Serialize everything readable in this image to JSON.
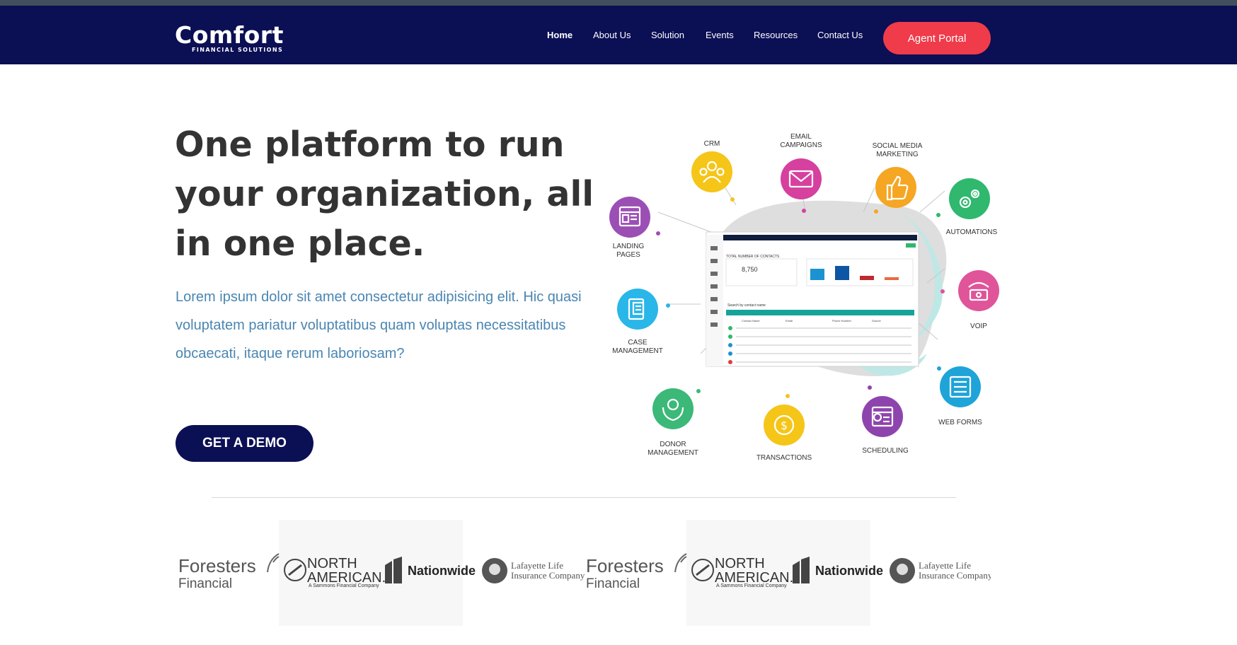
{
  "brand": {
    "name": "Comfort",
    "tagline": "FINANCIAL SOLUTIONS"
  },
  "nav": {
    "items": [
      {
        "label": "Home",
        "active": true
      },
      {
        "label": "About Us",
        "active": false
      },
      {
        "label": "Solution",
        "active": false
      },
      {
        "label": "Events",
        "active": false
      },
      {
        "label": "Resources",
        "active": false
      },
      {
        "label": "Contact Us",
        "active": false
      }
    ],
    "agent_portal": "Agent Portal"
  },
  "hero": {
    "title": "One platform to run your organization, all in one place.",
    "body": "Lorem ipsum dolor sit amet consectetur adipisicing elit. Hic quasi voluptatem pariatur voluptatibus quam voluptas necessitatibus obcaecati, itaque rerum laboriosam?",
    "cta": "GET A DEMO"
  },
  "illustration": {
    "features": [
      {
        "label": "CRM",
        "icon": "people-icon",
        "color": "#f5c518"
      },
      {
        "label": "EMAIL CAMPAIGNS",
        "icon": "envelope-icon",
        "color": "#d6409f"
      },
      {
        "label": "SOCIAL MEDIA MARKETING",
        "icon": "thumbs-up-icon",
        "color": "#f5a623"
      },
      {
        "label": "AUTOMATIONS",
        "icon": "gears-icon",
        "color": "#2fb86e"
      },
      {
        "label": "LANDING PAGES",
        "icon": "webpage-icon",
        "color": "#9b4fb5"
      },
      {
        "label": "VOIP",
        "icon": "phone-icon",
        "color": "#e0549a"
      },
      {
        "label": "CASE MANAGEMENT",
        "icon": "case-icon",
        "color": "#29b6e8"
      },
      {
        "label": "WEB FORMS",
        "icon": "form-icon",
        "color": "#1ea4d9"
      },
      {
        "label": "DONOR MANAGEMENT",
        "icon": "donor-hands-icon",
        "color": "#3cb878"
      },
      {
        "label": "TRANSACTIONS",
        "icon": "dollar-icon",
        "color": "#f5c518"
      },
      {
        "label": "SCHEDULING",
        "icon": "calendar-icon",
        "color": "#8e44ad"
      }
    ],
    "dashboard": {
      "section": "TOTAL NUMBER OF CONTACTS",
      "total": "8,750",
      "table_title": "Search by contact name",
      "columns": [
        "Contact Name",
        "Email",
        "Phone Number",
        "Source"
      ]
    }
  },
  "partners": [
    {
      "name": "Foresters",
      "sub": "Financial"
    },
    {
      "name": "NORTH AMERICAN.",
      "sub": "A Sammons Financial Company"
    },
    {
      "name": "Nationwide",
      "sub": ""
    },
    {
      "name": "Lafayette Life",
      "sub": "Insurance Company"
    },
    {
      "name": "Foresters",
      "sub": "Financial"
    },
    {
      "name": "NORTH AMERICAN.",
      "sub": "A Sammons Financial Company"
    },
    {
      "name": "Nationwide",
      "sub": ""
    },
    {
      "name": "Lafayette Life",
      "sub": "Insurance Company"
    }
  ]
}
